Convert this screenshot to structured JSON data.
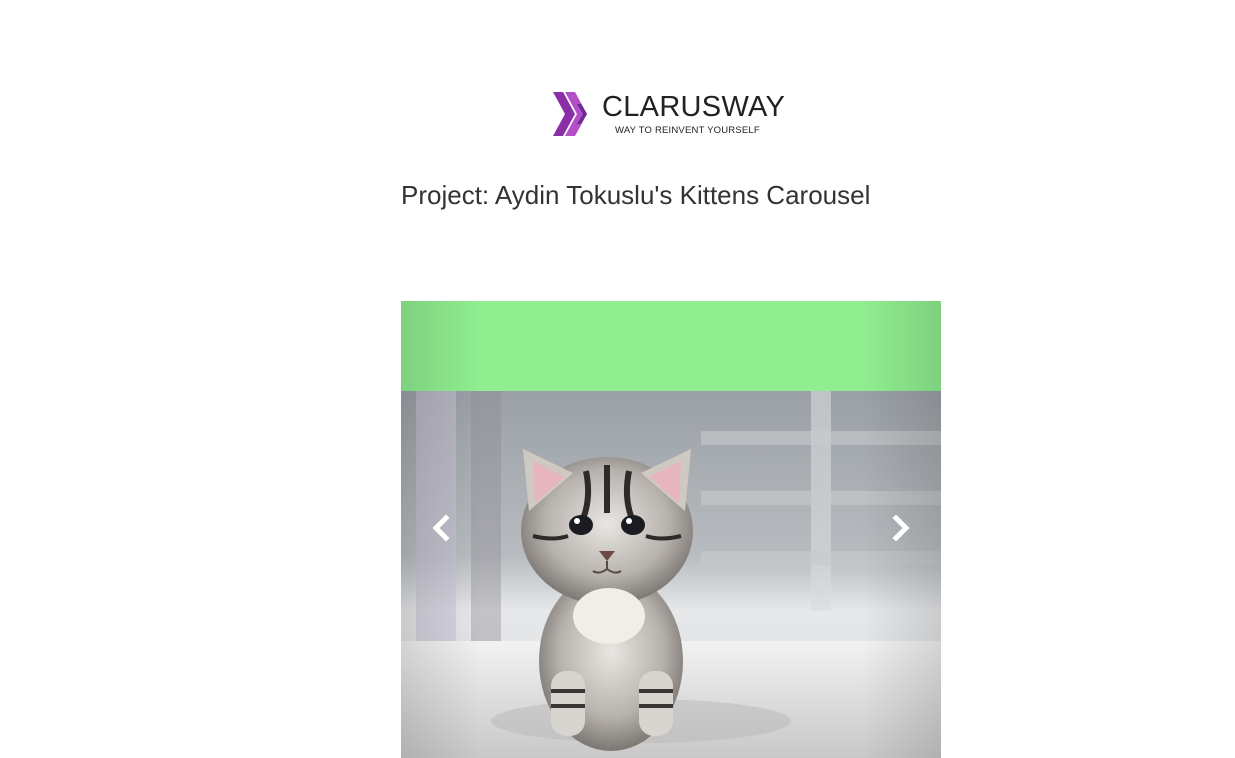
{
  "logo": {
    "name": "CLARUSWAY",
    "tagline": "WAY TO REINVENT YOURSELF",
    "colors": {
      "chevron_dark": "#6b2d8f",
      "chevron_light": "#b24fc7"
    }
  },
  "page": {
    "title": "Project: Aydin Tokuslu's Kittens Carousel"
  },
  "carousel": {
    "banner_color": "#90ee90",
    "slide_image": "kitten-photo",
    "controls": {
      "prev_icon": "chevron-left-icon",
      "next_icon": "chevron-right-icon"
    }
  }
}
